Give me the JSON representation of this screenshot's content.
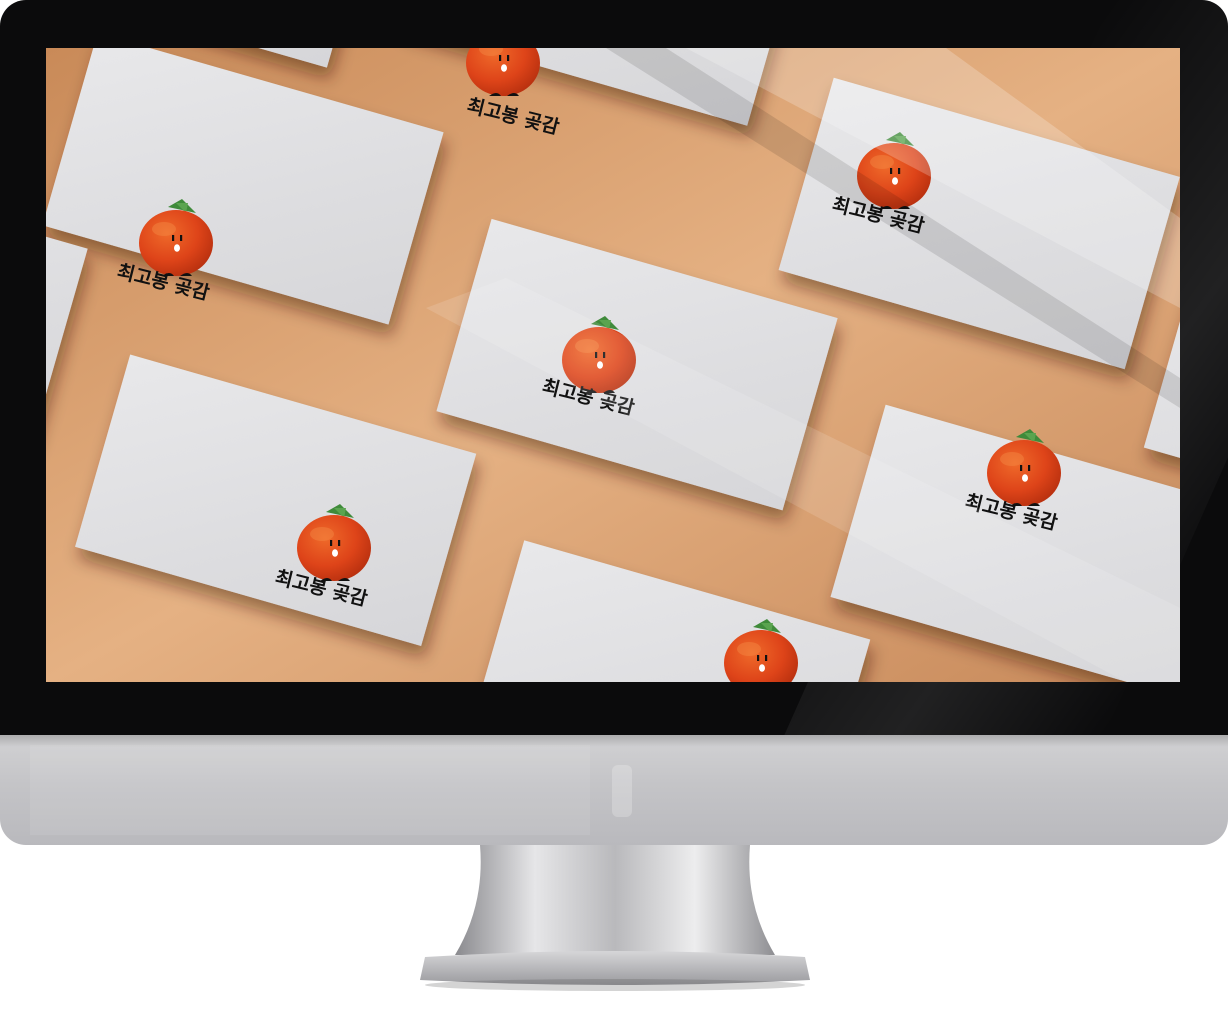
{
  "scene": {
    "description_visible": false,
    "cards": [
      {
        "label": "최고봉 곶감"
      },
      {
        "label": "최고봉 곶감"
      },
      {
        "label": "최고봉 곶감"
      },
      {
        "label": "최고봉 곶감"
      },
      {
        "label": "최고봉 곶감"
      },
      {
        "label": "최고봉 곶감"
      }
    ]
  },
  "colors": {
    "background_copper": "#d9a270",
    "card": "#e4e4e6",
    "persimmon": "#e0431c",
    "leaf": "#3f8a3a",
    "text": "#111111",
    "bezel": "#0b0b0c",
    "chin": "#c4c4c7"
  },
  "icons": {
    "mascot": "persimmon-mascot-icon",
    "brand": "apple-logo-icon"
  }
}
